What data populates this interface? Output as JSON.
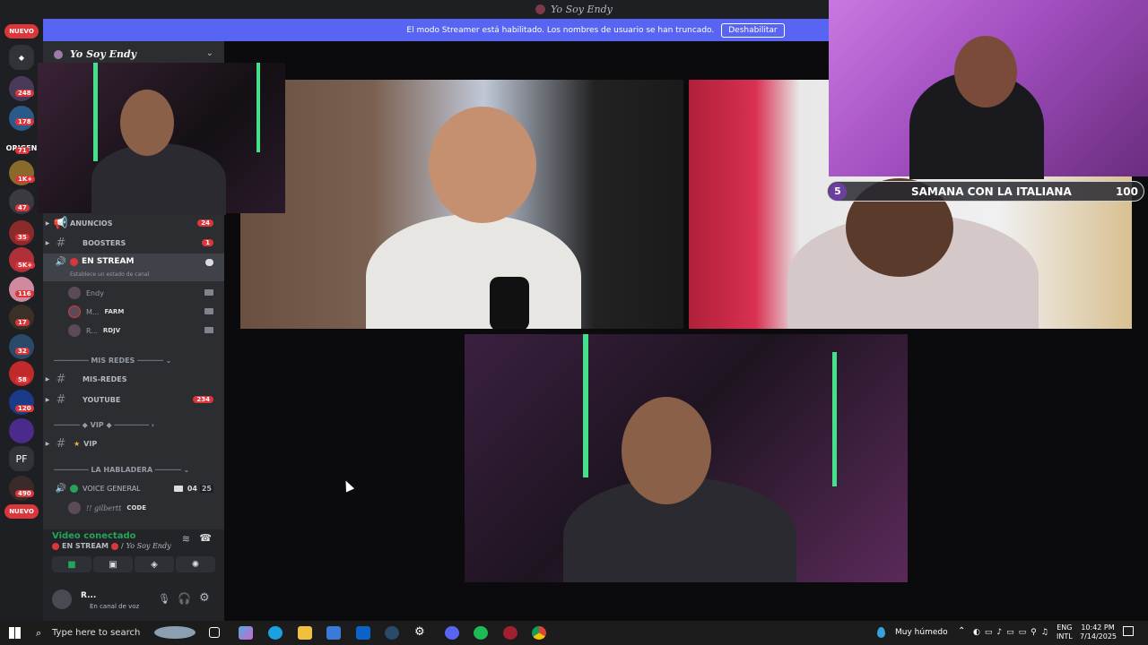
{
  "window": {
    "title": "Yo Soy Endy"
  },
  "banner": {
    "text": "El modo Streamer está habilitado. Los nombres de usuario se han truncado.",
    "button": "Deshabilitar"
  },
  "guilds": {
    "nuevo_top": "NUEVO",
    "nuevo_bottom": "NUEVO",
    "badges": [
      "248",
      "178",
      "71",
      "1K+",
      "47",
      "35",
      "5K+",
      "116",
      "17",
      "32",
      "58",
      "120",
      "490"
    ],
    "origen_label": "ORIGEN",
    "pf": "PF"
  },
  "server": {
    "name": "Yo Soy Endy"
  },
  "channels": [
    {
      "name": "ANUNCIOS",
      "count": "24"
    },
    {
      "name": "BOOSTERS",
      "count": "1"
    },
    {
      "name": "EN STREAM",
      "status": "Establece un estado de canal"
    },
    {
      "name": "MIS-REDES"
    },
    {
      "name": "YOUTUBE",
      "count": "234"
    },
    {
      "name": "VIP"
    },
    {
      "name": "VOICE GENERAL",
      "cam_count": "04",
      "users": "25"
    }
  ],
  "voice_users": [
    {
      "name": "Endy"
    },
    {
      "name": "M...",
      "tag": "FARM"
    },
    {
      "name": "R...",
      "tag": "RDJV"
    }
  ],
  "voice_general_user": {
    "name": "!! gilbertt",
    "tag": "CODE"
  },
  "categories": {
    "mis_redes": "MIS REDES",
    "vip": "VIP",
    "habladera": "LA HABLADERA"
  },
  "voice_status": {
    "title": "Video conectado",
    "channel": "EN STREAM",
    "server": "Yo Soy Endy"
  },
  "user_panel": {
    "name": "R...",
    "status": "En canal de voz"
  },
  "overlay": {
    "number": "5",
    "title": "SAMANA CON LA ITALIANA",
    "value": "100"
  },
  "taskbar": {
    "search": "Type here to search",
    "weather": "Muy húmedo",
    "lang1": "ENG",
    "lang2": "INTL",
    "time": "10:42 PM",
    "date": "7/14/2025"
  },
  "colors": {
    "accent": "#5865f2",
    "danger": "#da373c",
    "sidebar": "#2b2d31",
    "green": "#23a55a"
  }
}
